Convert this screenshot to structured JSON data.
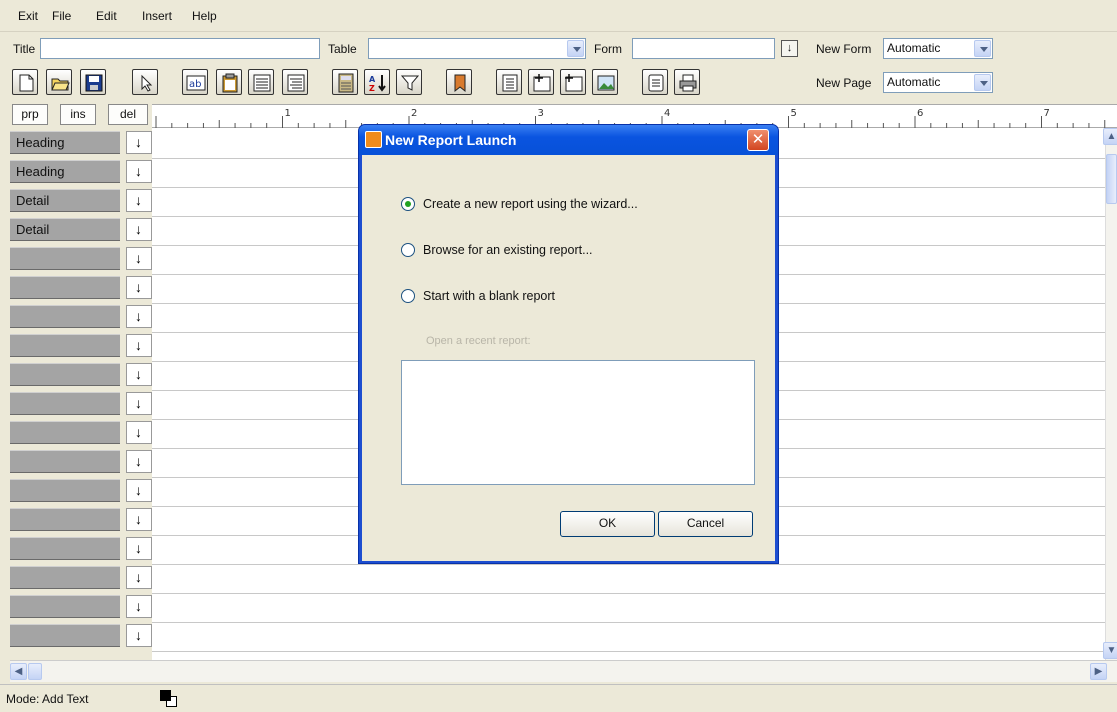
{
  "menu": [
    "Exit",
    "File",
    "Edit",
    "Insert",
    "Help"
  ],
  "toolbar1": {
    "title_label": "Title",
    "title_value": "",
    "table_label": "Table",
    "table_value": "",
    "form_label": "Form",
    "form_value": "",
    "new_form_label": "New Form",
    "new_form_value": "Automatic",
    "new_page_label": "New Page",
    "new_page_value": "Automatic"
  },
  "toolbar2_icons": [
    "new-document-icon",
    "open-folder-icon",
    "save-icon",
    "pointer-icon",
    "text-field-icon",
    "clipboard-icon",
    "align-left-icon",
    "align-right-icon",
    "calculator-icon",
    "sort-icon",
    "filter-icon",
    "bookmark-icon",
    "list-icon",
    "insert-column-icon",
    "insert-row-icon",
    "picture-icon",
    "notepad-icon",
    "print-icon"
  ],
  "tabs": {
    "prp": "prp",
    "ins": "ins",
    "del": "del"
  },
  "ruler_numbers": [
    "1",
    "2",
    "3",
    "4",
    "5",
    "6",
    "7"
  ],
  "bands": [
    "Heading",
    "Heading",
    "Detail",
    "Detail",
    "",
    "",
    "",
    "",
    "",
    "",
    "",
    "",
    "",
    "",
    "",
    "",
    "",
    ""
  ],
  "status": {
    "mode": "Mode: Add Text"
  },
  "dialog": {
    "title": "New Report Launch",
    "options": [
      {
        "label": "Create a new report using the wizard...",
        "checked": true
      },
      {
        "label": "Browse for an existing report...",
        "checked": false
      },
      {
        "label": "Start with a blank report",
        "checked": false
      }
    ],
    "recent_label": "Open a recent report:",
    "ok": "OK",
    "cancel": "Cancel"
  }
}
